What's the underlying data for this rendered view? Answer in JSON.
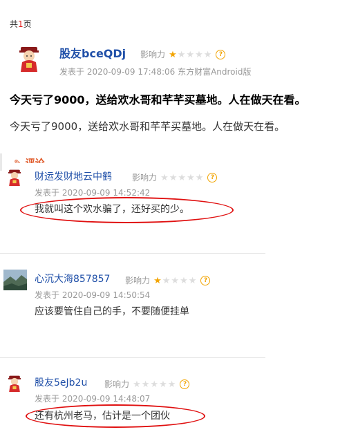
{
  "pager": {
    "prefix": "共",
    "page": "1",
    "suffix": "页"
  },
  "post": {
    "user": "股友bceQDj",
    "influence_label": "影响力",
    "rating": 1,
    "meta": "发表于 2020-09-09 17:48:06 东方财富Android版",
    "title": "今天亏了9000，送给欢水哥和芊芊买墓地。人在做天在看。",
    "body": "今天亏了9000，送给欢水哥和芊芊买墓地。人在做天在看。"
  },
  "comments_header": "评论",
  "comments": [
    {
      "user": "财运发财地云中鹤",
      "influence_label": "影响力",
      "rating": 0,
      "meta": "发表于 2020-09-09 14:52:42",
      "text": "我就叫这个欢水骗了，还好买的少。"
    },
    {
      "user": "心沉大海857857",
      "influence_label": "影响力",
      "rating": 1,
      "meta": "发表于 2020-09-09 14:50:54",
      "text": "应该要管住自己的手，不要随便挂单"
    },
    {
      "user": "股友5eJb2u",
      "influence_label": "影响力",
      "rating": 0,
      "meta": "发表于 2020-09-09 14:48:07",
      "text": "还有杭州老马，估计是一个团伙"
    }
  ],
  "colors": {
    "link": "#1f4fa8",
    "star": "#f2a400",
    "circle": "#e01010"
  }
}
